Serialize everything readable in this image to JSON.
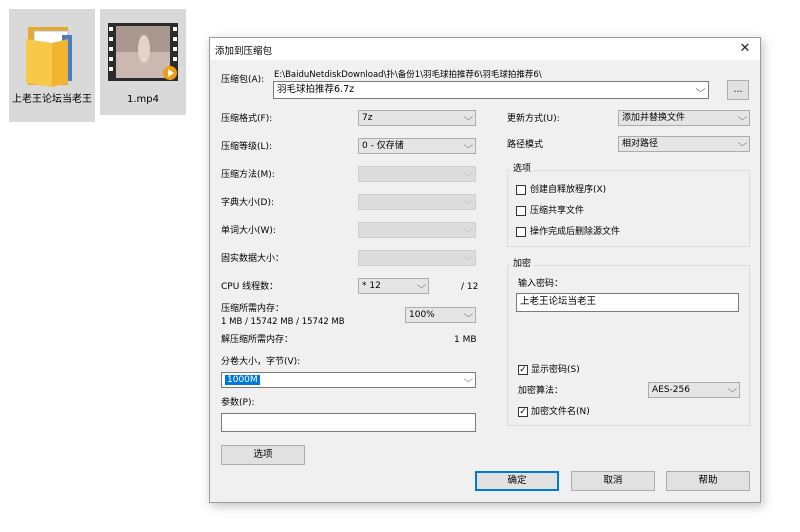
{
  "desktop": {
    "folder_label": "上老王论坛当老王",
    "video_label": "1.mp4"
  },
  "dialog": {
    "title": "添加到压缩包",
    "archive_label": "压缩包(A):",
    "archive_dir": "E:\\BaiduNetdiskDownload\\扑\\备份1\\羽毛球拍推荐6\\羽毛球拍推荐6\\",
    "archive_name": "羽毛球拍推荐6.7z",
    "browse_label": "...",
    "format_label": "压缩格式(F):",
    "format_value": "7z",
    "level_label": "压缩等级(L):",
    "level_value": "0 - 仅存储",
    "method_label": "压缩方法(M):",
    "dict_label": "字典大小(D):",
    "word_label": "单词大小(W):",
    "solid_label": "固实数据大小：",
    "cpu_label": "CPU 线程数：",
    "cpu_value": "* 12",
    "cpu_max": "/ 12",
    "mem_comp_label": "压缩所需内存：",
    "mem_comp_value": "1 MB / 15742 MB / 15742 MB",
    "mem_percent": "100%",
    "mem_decomp_label": "解压缩所需内存：",
    "mem_decomp_value": "1 MB",
    "split_label": "分卷大小，字节(V):",
    "split_value": "1000M",
    "params_label": "参数(P):",
    "options_button": "选项",
    "update_label": "更新方式(U):",
    "update_value": "添加并替换文件",
    "path_label": "路径模式",
    "path_value": "相对路径",
    "options_group": "选项",
    "opt_sfx": "创建自释放程序(X)",
    "opt_shared": "压缩共享文件",
    "opt_delete": "操作完成后删除源文件",
    "encrypt_group": "加密",
    "password_label": "输入密码：",
    "password_value": "上老王论坛当老王",
    "show_password": "显示密码(S)",
    "enc_method_label": "加密算法：",
    "enc_method_value": "AES-256",
    "encrypt_names": "加密文件名(N)",
    "ok_button": "确定",
    "cancel_button": "取消",
    "help_button": "帮助",
    "close_glyph": "✕",
    "dropdown_glyph": "⌵",
    "check_glyph": "✓"
  }
}
